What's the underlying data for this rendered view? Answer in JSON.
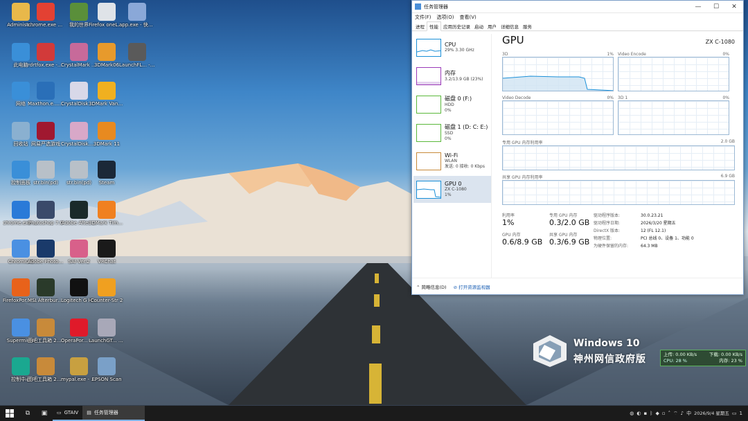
{
  "desktop_icons": [
    {
      "label": "Administr...",
      "icon": "user-folder-icon",
      "color": "#e8b84a"
    },
    {
      "label": "chrome.exe - 快捷方式",
      "icon": "chrome-icon",
      "color": "#e34133"
    },
    {
      "label": "我的世界",
      "icon": "minecraft-icon",
      "color": "#5a8f3a"
    },
    {
      "label": "Firefox oneLab.txt",
      "icon": "text-file-icon",
      "color": "#dfe3e8"
    },
    {
      "label": "app.exe - 快捷方式",
      "icon": "anime-app-icon",
      "color": "#8aa8d8"
    },
    {
      "label": "此电脑",
      "icon": "this-pc-icon",
      "color": "#3a8fd8"
    },
    {
      "label": "rdrtfox.exe - 快捷方式",
      "icon": "red-app-icon",
      "color": "#d23a3a"
    },
    {
      "label": "CrystalMark Retro Aoi ...",
      "icon": "crystalmark-icon",
      "color": "#c76a9a"
    },
    {
      "label": "3DMark06",
      "icon": "3dmark06-icon",
      "color": "#e79a2c"
    },
    {
      "label": "LaunchFL... - 快捷方式",
      "icon": "gta-icon",
      "color": "#5a5a5a"
    },
    {
      "label": "网络",
      "icon": "network-icon",
      "color": "#3a8fd8"
    },
    {
      "label": "Maxthon.e... - 快捷方式",
      "icon": "maxthon-icon",
      "color": "#2a6fb8"
    },
    {
      "label": "CrystalDisk Ghost ...",
      "icon": "crystaldisk-icon",
      "color": "#d8d8e8"
    },
    {
      "label": "3DMark Vantage",
      "icon": "3dmark-vantage-icon",
      "color": "#f0b020"
    },
    {
      "label": "回收站",
      "icon": "recycle-bin-icon",
      "color": "#8ab0d0"
    },
    {
      "label": "网易严选游戏",
      "icon": "game-launcher-icon",
      "color": "#a01830"
    },
    {
      "label": "CrystalDisk... Aoi Edition",
      "icon": "crystaldisk-aoi-icon",
      "color": "#d8a8c8"
    },
    {
      "label": "3DMark 11",
      "icon": "3dmark11-icon",
      "color": "#e88a20"
    },
    {
      "label": "控制面板",
      "icon": "control-panel-icon",
      "color": "#3a8fd8"
    },
    {
      "label": "str.bin(pd)",
      "icon": "file-icon",
      "color": "#b8c0c8"
    },
    {
      "label": "str.bin(pd)",
      "icon": "file-icon",
      "color": "#b8c0c8"
    },
    {
      "label": "Steam",
      "icon": "steam-icon",
      "color": "#1b2838"
    },
    {
      "label": "chrome.exe - 快捷方式",
      "icon": "chrome-icon",
      "color": "#2a7ad8"
    },
    {
      "label": "Photoshop 7.0",
      "icon": "photoshop7-icon",
      "color": "#3a4a6a"
    },
    {
      "label": "Adobe After ...",
      "icon": "after-effects-icon",
      "color": "#1a2a2a"
    },
    {
      "label": "3DMark Time Spy",
      "icon": "3dmark-timespy-icon",
      "color": "#f08020"
    },
    {
      "label": "Chromium",
      "icon": "chromium-icon",
      "color": "#4a90e2"
    },
    {
      "label": "Adobe Photosh...",
      "icon": "photoshop-icon",
      "color": "#1a3a6a"
    },
    {
      "label": "SAI Ver.2",
      "icon": "sai-icon",
      "color": "#d8608a"
    },
    {
      "label": "VRChat",
      "icon": "vrchat-icon",
      "color": "#1a1a1a"
    },
    {
      "label": "FirefoxPor... - 快捷方式",
      "icon": "firefox-icon",
      "color": "#e8621a"
    },
    {
      "label": "MSI Afterburner",
      "icon": "msi-afterburner-icon",
      "color": "#2a3a2a"
    },
    {
      "label": "Logitech G HUB",
      "icon": "logitech-icon",
      "color": "#111111"
    },
    {
      "label": "Counter-Str 2",
      "icon": "cs2-icon",
      "color": "#f0a020"
    },
    {
      "label": "Supermium",
      "icon": "supermium-icon",
      "color": "#4a90e2"
    },
    {
      "label": "图吧工具箱 2025.exe...",
      "icon": "toolbox-icon",
      "color": "#c88a3a"
    },
    {
      "label": "OperaPor... - 快捷方式",
      "icon": "opera-icon",
      "color": "#e01a2a"
    },
    {
      "label": "LaunchGT... - 快捷方式",
      "icon": "gta-launcher-icon",
      "color": "#a8a8b8"
    },
    {
      "label": "控制中心",
      "icon": "control-center-icon",
      "color": "#1aa890"
    },
    {
      "label": "图吧工具箱 2023",
      "icon": "toolbox2023-icon",
      "color": "#c88a3a"
    },
    {
      "label": "mypal.exe - 快捷方式",
      "icon": "mypal-icon",
      "color": "#c8a040"
    },
    {
      "label": "EPSON Scan",
      "icon": "epson-scan-icon",
      "color": "#7aa0c8"
    }
  ],
  "task_manager": {
    "title": "任务管理器",
    "window_controls": {
      "minimize": "—",
      "maximize": "☐",
      "close": "✕"
    },
    "menu": [
      "文件(F)",
      "选项(O)",
      "查看(V)"
    ],
    "tabs": [
      "进程",
      "性能",
      "应用历史记录",
      "启动",
      "用户",
      "详细信息",
      "服务"
    ],
    "active_tab": "性能",
    "resources": [
      {
        "name": "CPU",
        "line1": "29% 3.30 GHz",
        "line2": "",
        "color": "#1a8fd8"
      },
      {
        "name": "内存",
        "line1": "3.2/13.9 GB (23%)",
        "line2": "",
        "color": "#9a3ab8"
      },
      {
        "name": "磁盘 0 (F:)",
        "line1": "HDD",
        "line2": "0%",
        "color": "#5ab83a"
      },
      {
        "name": "磁盘 1 (D: C: E:)",
        "line1": "SSD",
        "line2": "0%",
        "color": "#5ab83a"
      },
      {
        "name": "Wi-Fi",
        "line1": "WLAN",
        "line2": "发送: 0 接收: 0 Kbps",
        "color": "#c88a3a"
      },
      {
        "name": "GPU 0",
        "line1": "ZX C-1080",
        "line2": "1%",
        "color": "#1a8fd8"
      }
    ],
    "gpu": {
      "heading": "GPU",
      "model": "ZX C-1080",
      "graphs": [
        {
          "label": "3D",
          "value": "1%"
        },
        {
          "label": "Video Encode",
          "value": "0%"
        },
        {
          "label": "Video Decode",
          "value": "0%"
        },
        {
          "label": "3D 1",
          "value": "0%"
        }
      ],
      "dedicated_label": "专用 GPU 内存利用率",
      "dedicated_max": "2.0 GB",
      "shared_label": "共享 GPU 内存利用率",
      "shared_max": "6.9 GB",
      "stats": [
        {
          "label": "利用率",
          "value": "1%"
        },
        {
          "label": "专用 GPU 内存",
          "value": "0.3/2.0 GB"
        },
        {
          "label": "GPU 内存",
          "value": "0.6/8.9 GB"
        },
        {
          "label": "共享 GPU 内存",
          "value": "0.3/6.9 GB"
        }
      ],
      "details": [
        {
          "k": "驱动程序版本:",
          "v": "30.0.23.21"
        },
        {
          "k": "驱动程序日期:",
          "v": "2026/3/20 星期五"
        },
        {
          "k": "DirectX 版本:",
          "v": "12 (FL 12.1)"
        },
        {
          "k": "物理位置:",
          "v": "PCI 总线 0、设备 1、功能 0"
        },
        {
          "k": "为硬件保留的内存:",
          "v": "64.3 MB"
        }
      ]
    },
    "footer": {
      "brief": "简略信息(D)",
      "link": "打开资源监视器"
    }
  },
  "brand": {
    "line1": "Windows 10",
    "line2": "神州网信政府版"
  },
  "netmon": {
    "up": "上传: 0.00 KB/s",
    "down": "下载: 0.00 KB/s",
    "cpu": "CPU: 28 %",
    "mem": "内存: 23 %"
  },
  "taskbar": {
    "apps": [
      {
        "label": "GTAIV",
        "active": false
      },
      {
        "label": "任务管理器",
        "active": true
      }
    ],
    "tray": {
      "time": "",
      "date": "2026/9/4 星期五",
      "lang": "中",
      "notif": "1"
    }
  }
}
